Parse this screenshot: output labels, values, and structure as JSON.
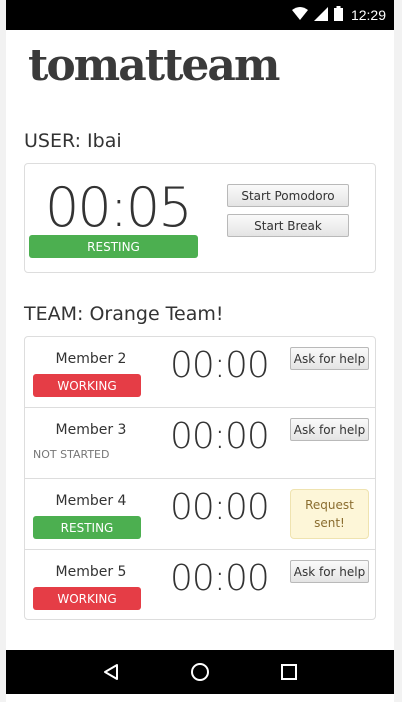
{
  "status_bar": {
    "time": "12:29",
    "icons": [
      "wifi-icon",
      "signal-icon",
      "battery-icon"
    ]
  },
  "app": {
    "logo": "tomatteam"
  },
  "user": {
    "title": "USER: Ibai",
    "timer": "00:05",
    "status": "RESTING",
    "start_pomodoro_label": "Start Pomodoro",
    "start_break_label": "Start Break"
  },
  "team": {
    "title": "TEAM: Orange Team!",
    "members": [
      {
        "name": "Member 2",
        "status": "WORKING",
        "timer": "00:00",
        "action": "Ask for help"
      },
      {
        "name": "Member 3",
        "status": "NOT STARTED",
        "timer": "00:00",
        "action": "Ask for help"
      },
      {
        "name": "Member 4",
        "status": "RESTING",
        "timer": "00:00",
        "action": "Request sent!"
      },
      {
        "name": "Member 5",
        "status": "WORKING",
        "timer": "00:00",
        "action": "Ask for help"
      }
    ]
  },
  "colors": {
    "working": "#e53d46",
    "resting": "#4caf50",
    "request_sent_bg": "#fdf6d8"
  },
  "nav_bar": {
    "icons": [
      "back-icon",
      "home-icon",
      "recents-icon"
    ]
  }
}
